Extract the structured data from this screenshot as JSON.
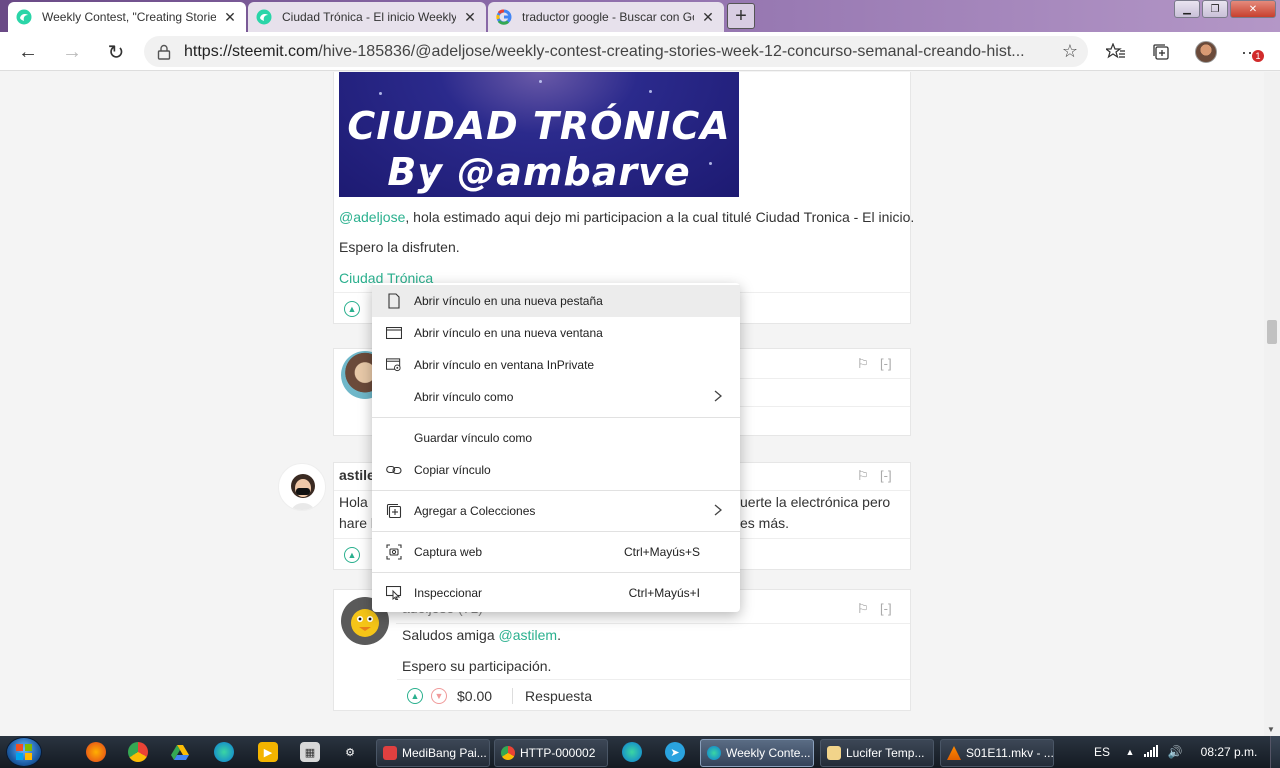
{
  "browser": {
    "tabs": [
      {
        "title": "Weekly Contest, \"Creating Storie",
        "active": true
      },
      {
        "title": "Ciudad Trónica - El inicio Weekly",
        "active": false
      },
      {
        "title": "traductor google - Buscar con Go",
        "active": false
      }
    ],
    "url_host": "https://steemit.com",
    "url_path": "/hive-185836/@adeljose/weekly-contest-creating-stories-week-12-concurso-semanal-creando-hist...",
    "new_tab": "+",
    "notification_badge": "1"
  },
  "post": {
    "banner_line1": "CIUDAD TRÓNICA",
    "banner_line2": "By @ambarve",
    "mention": "@adeljose",
    "paragraph1_rest": ", hola estimado aqui dejo mi participacion a la cual titulé Ciudad Tronica - El inicio.",
    "paragraph2": "Espero la disfruten.",
    "link_text": "Ciudad Trónica"
  },
  "comments": [
    {
      "author": "astile",
      "text_line1_start": "Hola",
      "text_line1_end": "uerte la electrónica pero",
      "text_line2_start": "hare l",
      "text_line2_end": "es más."
    },
    {
      "author": "adeljose (71)",
      "text1_start": "Saludos amiga ",
      "text1_mention": "@astilem",
      "text1_end": ".",
      "text2": "Espero su participación.",
      "payout": "$0.00",
      "reply": "Respuesta"
    }
  ],
  "common": {
    "collapse": "[-]",
    "flag": "⚐"
  },
  "context_menu": {
    "items": [
      {
        "label": "Abrir vínculo en una nueva pestaña"
      },
      {
        "label": "Abrir vínculo en una nueva ventana"
      },
      {
        "label": "Abrir vínculo en ventana InPrivate"
      },
      {
        "label": "Abrir vínculo como"
      },
      {
        "label": "Guardar vínculo como"
      },
      {
        "label": "Copiar vínculo"
      },
      {
        "label": "Agregar a Colecciones"
      },
      {
        "label": "Captura web",
        "shortcut": "Ctrl+Mayús+S"
      },
      {
        "label": "Inspeccionar",
        "shortcut": "Ctrl+Mayús+I"
      }
    ]
  },
  "taskbar": {
    "tasks": [
      {
        "label": "MediBang Pai..."
      },
      {
        "label": "HTTP-000002"
      },
      {
        "label": "Weekly Conte..."
      },
      {
        "label": "Lucifer Temp..."
      },
      {
        "label": "S01E11.mkv - ..."
      }
    ],
    "language": "ES",
    "time": "08:27 p.m."
  },
  "colors": {
    "steem_green": "#2ab08e",
    "taskbar": "#1c2430",
    "banner_bg": "#1d1a72"
  }
}
